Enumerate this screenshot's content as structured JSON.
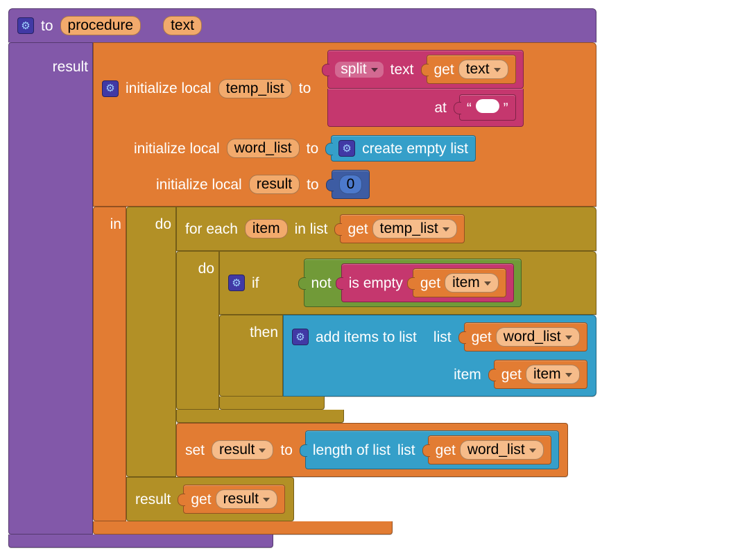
{
  "proc": {
    "to": "to",
    "name": "procedure",
    "param": "text",
    "result": "result"
  },
  "locals": {
    "initialize": "initialize local",
    "to": "to",
    "temp_list": "temp_list",
    "word_list": "word_list",
    "result_name": "result",
    "in": "in"
  },
  "split": {
    "label": "split",
    "text": "text",
    "at": "at",
    "space": " "
  },
  "get": "get",
  "vars": {
    "text": "text",
    "temp_list": "temp_list",
    "item": "item",
    "word_list": "word_list",
    "result": "result"
  },
  "list": {
    "create_empty": "create empty list",
    "add_items": "add items to list",
    "list_word": "list",
    "item_word": "item",
    "length": "length of list",
    "in_list": "in list"
  },
  "num": {
    "zero": "0"
  },
  "ctrl": {
    "for_each": "for each",
    "do": "do",
    "if": "if",
    "then": "then",
    "result": "result"
  },
  "logic": {
    "not": "not",
    "is_empty": "is empty"
  },
  "set": {
    "label": "set",
    "to": "to"
  }
}
